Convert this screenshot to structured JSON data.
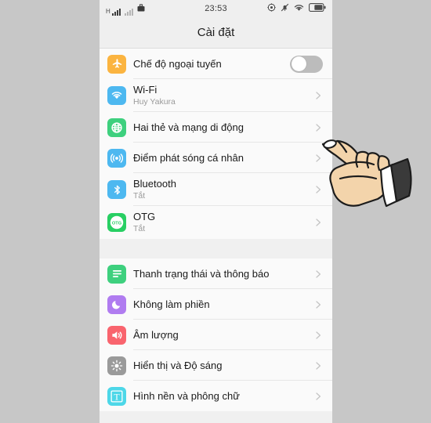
{
  "status_bar": {
    "carrier_mode": "H",
    "signal_label": "signal-bars-icon",
    "signal2_label": "signal-bars-dim-icon",
    "briefcase_label": "briefcase-icon",
    "time": "23:53",
    "location_label": "location-icon",
    "mute_label": "mute-bell-icon",
    "wifi_label": "wifi-icon",
    "battery_label": "battery-icon"
  },
  "header": {
    "title": "Cài đặt"
  },
  "groups": [
    {
      "id": "connectivity",
      "rows": [
        {
          "name": "airplane-mode",
          "label": "Chế độ ngoại tuyến",
          "sub": "",
          "icon": "airplane-icon",
          "icon_color": "#fbb440",
          "control": "toggle",
          "toggle_on": false
        },
        {
          "name": "wifi",
          "label": "Wi-Fi",
          "sub": "Huy Yakura",
          "icon": "wifi-icon",
          "icon_color": "#4db8f0",
          "control": "chevron"
        },
        {
          "name": "dual-sim-mobile-network",
          "label": "Hai thẻ và mạng di động",
          "sub": "",
          "icon": "globe-icon",
          "icon_color": "#3ed07e",
          "control": "chevron"
        },
        {
          "name": "personal-hotspot",
          "label": "Điểm phát sóng cá nhân",
          "sub": "",
          "icon": "hotspot-icon",
          "icon_color": "#4db8f0",
          "control": "chevron"
        },
        {
          "name": "bluetooth",
          "label": "Bluetooth",
          "sub": "Tắt",
          "icon": "bluetooth-icon",
          "icon_color": "#4db8f0",
          "control": "chevron"
        },
        {
          "name": "otg",
          "label": "OTG",
          "sub": "Tắt",
          "icon": "otg-icon",
          "icon_color": "#28cf63",
          "control": "chevron"
        }
      ]
    },
    {
      "id": "device",
      "rows": [
        {
          "name": "status-bar-notifications",
          "label": "Thanh trạng thái và thông báo",
          "sub": "",
          "icon": "list-icon",
          "icon_color": "#3ed07e",
          "control": "chevron"
        },
        {
          "name": "do-not-disturb",
          "label": "Không làm phiền",
          "sub": "",
          "icon": "moon-icon",
          "icon_color": "#b07cf0",
          "control": "chevron"
        },
        {
          "name": "volume",
          "label": "Âm lượng",
          "sub": "",
          "icon": "speaker-icon",
          "icon_color": "#f9646e",
          "control": "chevron"
        },
        {
          "name": "display-brightness",
          "label": "Hiển thị và Độ sáng",
          "sub": "",
          "icon": "brightness-icon",
          "icon_color": "#9a9a9a",
          "control": "chevron"
        },
        {
          "name": "wallpaper-font",
          "label": "Hình nền và phông chữ",
          "sub": "",
          "icon": "text-icon",
          "icon_color": "#4dd7e8",
          "control": "chevron"
        }
      ]
    }
  ],
  "cursor": {
    "name": "pointing-hand-cursor"
  },
  "colors": {
    "page_background": "#c7c7c7",
    "screen_background": "#f2f2f2",
    "row_background": "#fafafa",
    "divider": "#e6e6e6",
    "label": "#1a1a1a",
    "sublabel": "#9a9a9a"
  }
}
